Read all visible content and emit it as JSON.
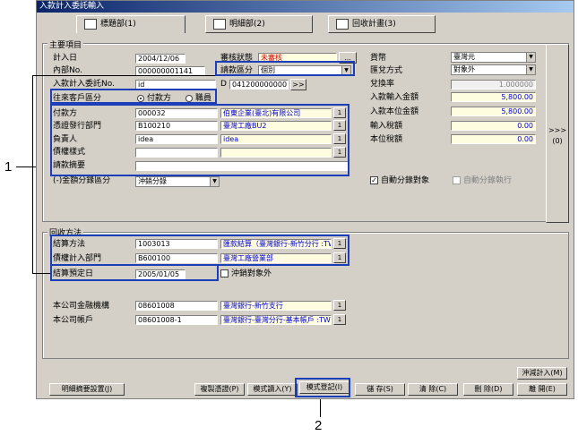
{
  "window": {
    "title": "入款計入委託輸入"
  },
  "tabs": [
    {
      "label": "標題部(1)"
    },
    {
      "label": "明細部(2)"
    },
    {
      "label": "回收計畫(3)"
    }
  ],
  "main_group": {
    "title": "主要項目",
    "entry_date_label": "計入日",
    "entry_date": "2004/12/06",
    "internal_no_label": "內部No.",
    "internal_no": "000000001141",
    "request_no_label": "入款計入委託No.",
    "request_no": "id",
    "approval_label": "審核狀態",
    "approval_value": "未審核",
    "approval_btn": "...",
    "entry_class_label": "請款區分",
    "entry_class_value": "個別",
    "d_label": "D",
    "d_value": "0412000000001",
    "d_btn": ">>",
    "partner_class_label": "往來客戶區分",
    "radio_payer": "付款方",
    "radio_staff": "職員",
    "payer_label": "付款方",
    "payer_code": "000032",
    "payer_name": "伯東企業(臺北)有限公司",
    "dept_label": "憑證發行部門",
    "dept_code": "B100210",
    "dept_name": "臺灣工廠BU2",
    "owner_label": "負責人",
    "owner_code": "idea",
    "owner_name": "idea",
    "claim_type_label": "債權樣式",
    "claim_summary_label": "請款摘要",
    "offset_label": "(-)金額分錄區分",
    "offset_value": "沖銷分錄",
    "currency_label": "貨幣",
    "currency_value": "臺灣元",
    "exchange_method_label": "匯兌方式",
    "exchange_method_value": "對象外",
    "rate_label": "兌換率",
    "rate_value": "1.000000",
    "amount_label": "入款輸入金額",
    "amount_value": "5,800.00",
    "local_amount_label": "入款本位金額",
    "local_amount_value": "5,800.00",
    "input_tax_label": "輸入稅額",
    "input_tax_value": "0.00",
    "local_tax_label": "本位稅額",
    "local_tax_value": "0.00",
    "auto_entry_label": "自動分錄對象",
    "auto_exec_label": "自動分錄執行",
    "side_btn": ">>>",
    "side_btn_key": "(0)"
  },
  "recovery_group": {
    "title": "回收方法",
    "settle_label": "結算方法",
    "settle_code": "1003013",
    "settle_name": "匯款結算（臺灣銀行-新竹分行 :TWD）",
    "claim_dept_label": "債權計入部門",
    "claim_dept_code": "B600100",
    "claim_dept_name": "臺灣工廠營業部",
    "settle_date_label": "結算預定日",
    "settle_date": "2005/01/05",
    "offset_target_label": "沖銷對象外",
    "bank_label": "本公司金融機構",
    "bank_code": "08601008",
    "bank_name": "臺灣銀行-新竹支行",
    "account_label": "本公司帳戶",
    "account_code": "08601008-1",
    "account_name": "臺灣銀行-臺灣分行-基本帳戶 :TWD"
  },
  "toolbar": {
    "detail_summary": "明細摘要設置(J)",
    "copy_voucher": "複製憑證(P)",
    "template_load": "模式讀入(Y)",
    "template_register": "模式登記(I)",
    "save": "儲 存(S)",
    "clear": "清 除(C)",
    "delete": "刪 除(D)",
    "close": "離 開(E)",
    "offset_entry": "沖減計入(M)"
  },
  "callouts": {
    "one": "1",
    "two": "2"
  },
  "colors": {
    "highlight": "#1a3fb8",
    "titlebar": "#0a246a",
    "face": "#d4d0c8"
  }
}
